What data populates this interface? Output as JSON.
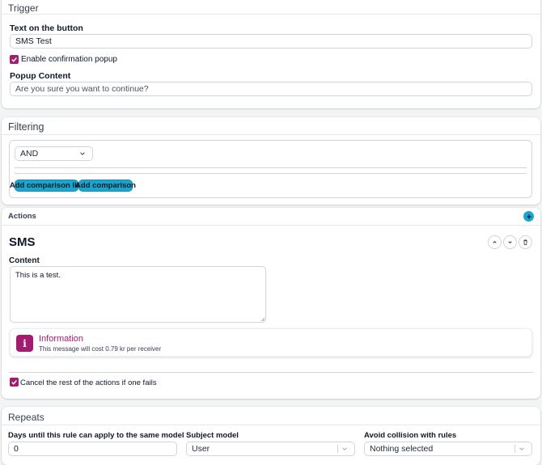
{
  "trigger": {
    "title": "Trigger",
    "button_text_label": "Text on the button",
    "button_text_value": "SMS Test",
    "confirmation_label": "Enable confirmation popup",
    "popup_content_label": "Popup Content",
    "popup_content_placeholder": "Are you sure you want to continue?"
  },
  "filtering": {
    "title": "Filtering",
    "operator": "AND",
    "add_comparison_list_label": "Add comparison list",
    "add_comparison_label": "Add comparison"
  },
  "actions": {
    "title": "Actions",
    "add_icon": "plus-icon",
    "action_title": "SMS",
    "content_label": "Content",
    "content_value": "This is a test.",
    "info_title": "Information",
    "info_text": "This message will cost 0.79 kr per receiver",
    "cancel_label": "Cancel the rest of the actions if one fails"
  },
  "repeats": {
    "title": "Repeats",
    "days_label": "Days until this rule can apply to the same model",
    "days_value": "0",
    "subject_label": "Subject model",
    "subject_value": "User",
    "collision_label": "Avoid collision with rules",
    "collision_value": "Nothing selected"
  },
  "colors": {
    "accent_purple": "#a21c72",
    "accent_teal": "#1aa6cc"
  }
}
